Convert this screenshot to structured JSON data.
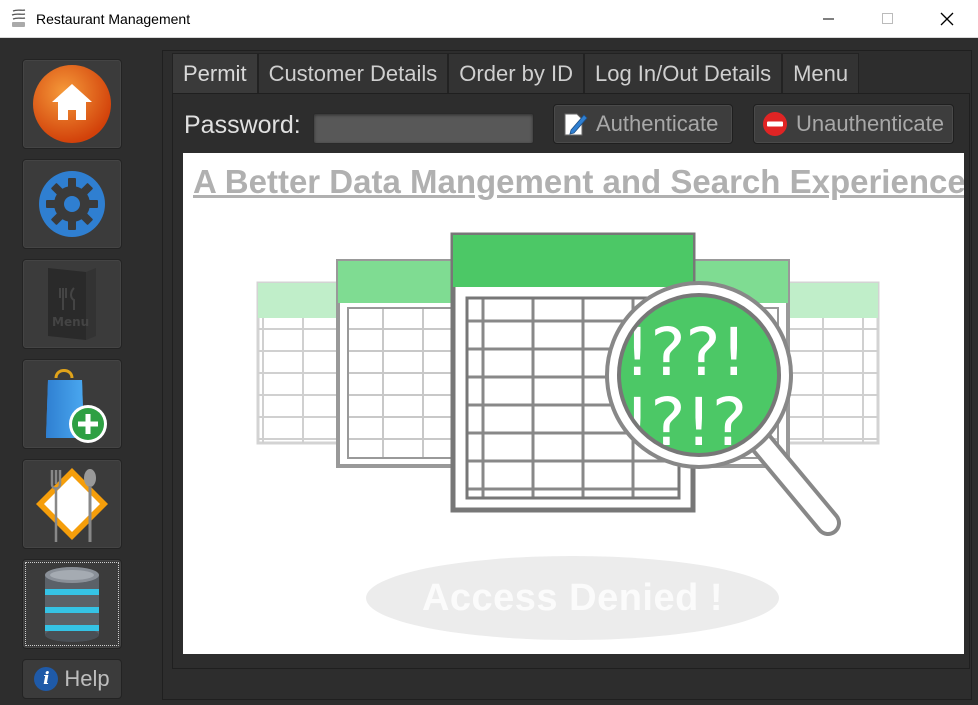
{
  "window": {
    "title": "Restaurant Management",
    "controls": {
      "minimize": "minimize-icon",
      "maximize": "maximize-icon",
      "close": "close-icon"
    }
  },
  "sidebar": {
    "items": [
      {
        "name": "home",
        "icon": "home-icon",
        "color": "#e8590c"
      },
      {
        "name": "settings",
        "icon": "gear-icon",
        "color": "#2f7fd1"
      },
      {
        "name": "menu",
        "icon": "menu-card-icon",
        "color": "#3a3a3a"
      },
      {
        "name": "add-order",
        "icon": "shopping-bag-plus-icon",
        "color": "#2ea043"
      },
      {
        "name": "dining",
        "icon": "plate-fork-spoon-icon",
        "color": "#f59e0b"
      },
      {
        "name": "database",
        "icon": "database-icon",
        "color": "#2aa3c7"
      }
    ],
    "help_label": "Help"
  },
  "tabs": [
    {
      "label": "Permit",
      "active": true
    },
    {
      "label": "Customer Details",
      "active": false
    },
    {
      "label": "Order by ID",
      "active": false
    },
    {
      "label": "Log In/Out Details",
      "active": false
    },
    {
      "label": "Menu",
      "active": false
    }
  ],
  "auth": {
    "password_label": "Password:",
    "password_value": "",
    "authenticate_label": "Authenticate",
    "unauthenticate_label": "Unauthenticate"
  },
  "banner": {
    "headline": "A Better Data Mangement and Search Experience",
    "status": "Access Denied  !",
    "overlay_text": "!??!",
    "overlay_text_2": "!?!?"
  },
  "colors": {
    "background": "#2d2d2d",
    "accent_green": "#4cc866",
    "text_muted": "#b0b0b0"
  }
}
